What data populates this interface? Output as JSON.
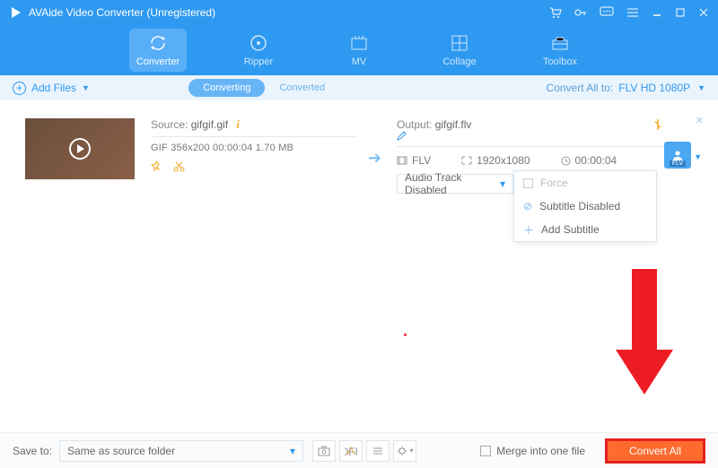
{
  "app": {
    "title": "AVAide Video Converter (Unregistered)"
  },
  "nav": {
    "converter": "Converter",
    "ripper": "Ripper",
    "mv": "MV",
    "collage": "Collage",
    "toolbox": "Toolbox"
  },
  "subbar": {
    "add_files": "Add Files",
    "tabs": {
      "converting": "Converting",
      "converted": "Converted"
    },
    "convert_all_to_label": "Convert All to:",
    "convert_all_to_value": "FLV HD 1080P"
  },
  "item": {
    "source_label": "Source:",
    "source_name": "gifgif.gif",
    "source_meta": "GIF   356x200   00:00:04   1.70 MB",
    "output_label": "Output:",
    "output_name": "gifgif.flv",
    "format_ext": "FLV",
    "out_container": "FLV",
    "out_res": "1920x1080",
    "out_dur": "00:00:04",
    "audio_dd": "Audio Track Disabled",
    "sub_dd": "Subtitle Disabled",
    "sub_menu": {
      "force": "Force",
      "disabled": "Subtitle Disabled",
      "add": "Add Subtitle"
    }
  },
  "footer": {
    "save_to_label": "Save to:",
    "save_to_value": "Same as source folder",
    "merge_label": "Merge into one file",
    "convert_btn": "Convert All"
  }
}
